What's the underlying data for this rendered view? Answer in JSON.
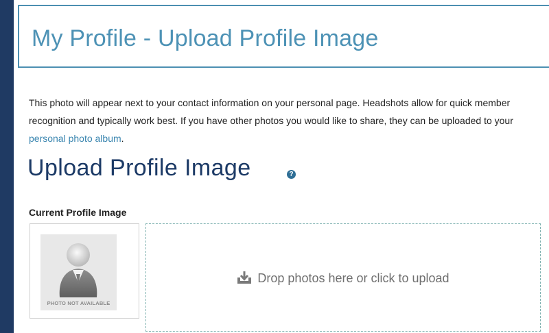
{
  "header": {
    "title": "My Profile - Upload Profile Image"
  },
  "intro": {
    "text_before_link": "This photo will appear next to your contact information on your personal page. Headshots allow for quick member recognition and typically work best. If you have other photos you would like to share, they can be uploaded to your ",
    "link_text": "personal photo album",
    "text_after_link": "."
  },
  "upload_section": {
    "heading": "Upload Profile Image",
    "help_icon": "?",
    "current_label": "Current Profile Image",
    "avatar_caption": "PHOTO NOT AVAILABLE",
    "dropzone_text": "Drop photos here or click to upload"
  },
  "colors": {
    "sidebar": "#1f3a63",
    "title_text": "#4d92b5",
    "heading_text": "#1c3a66",
    "link": "#3b86b0",
    "dropzone_border": "#7fb2b0"
  },
  "icons": {
    "help": "question-circle-icon",
    "upload": "upload-icon",
    "avatar": "person-silhouette-icon"
  }
}
